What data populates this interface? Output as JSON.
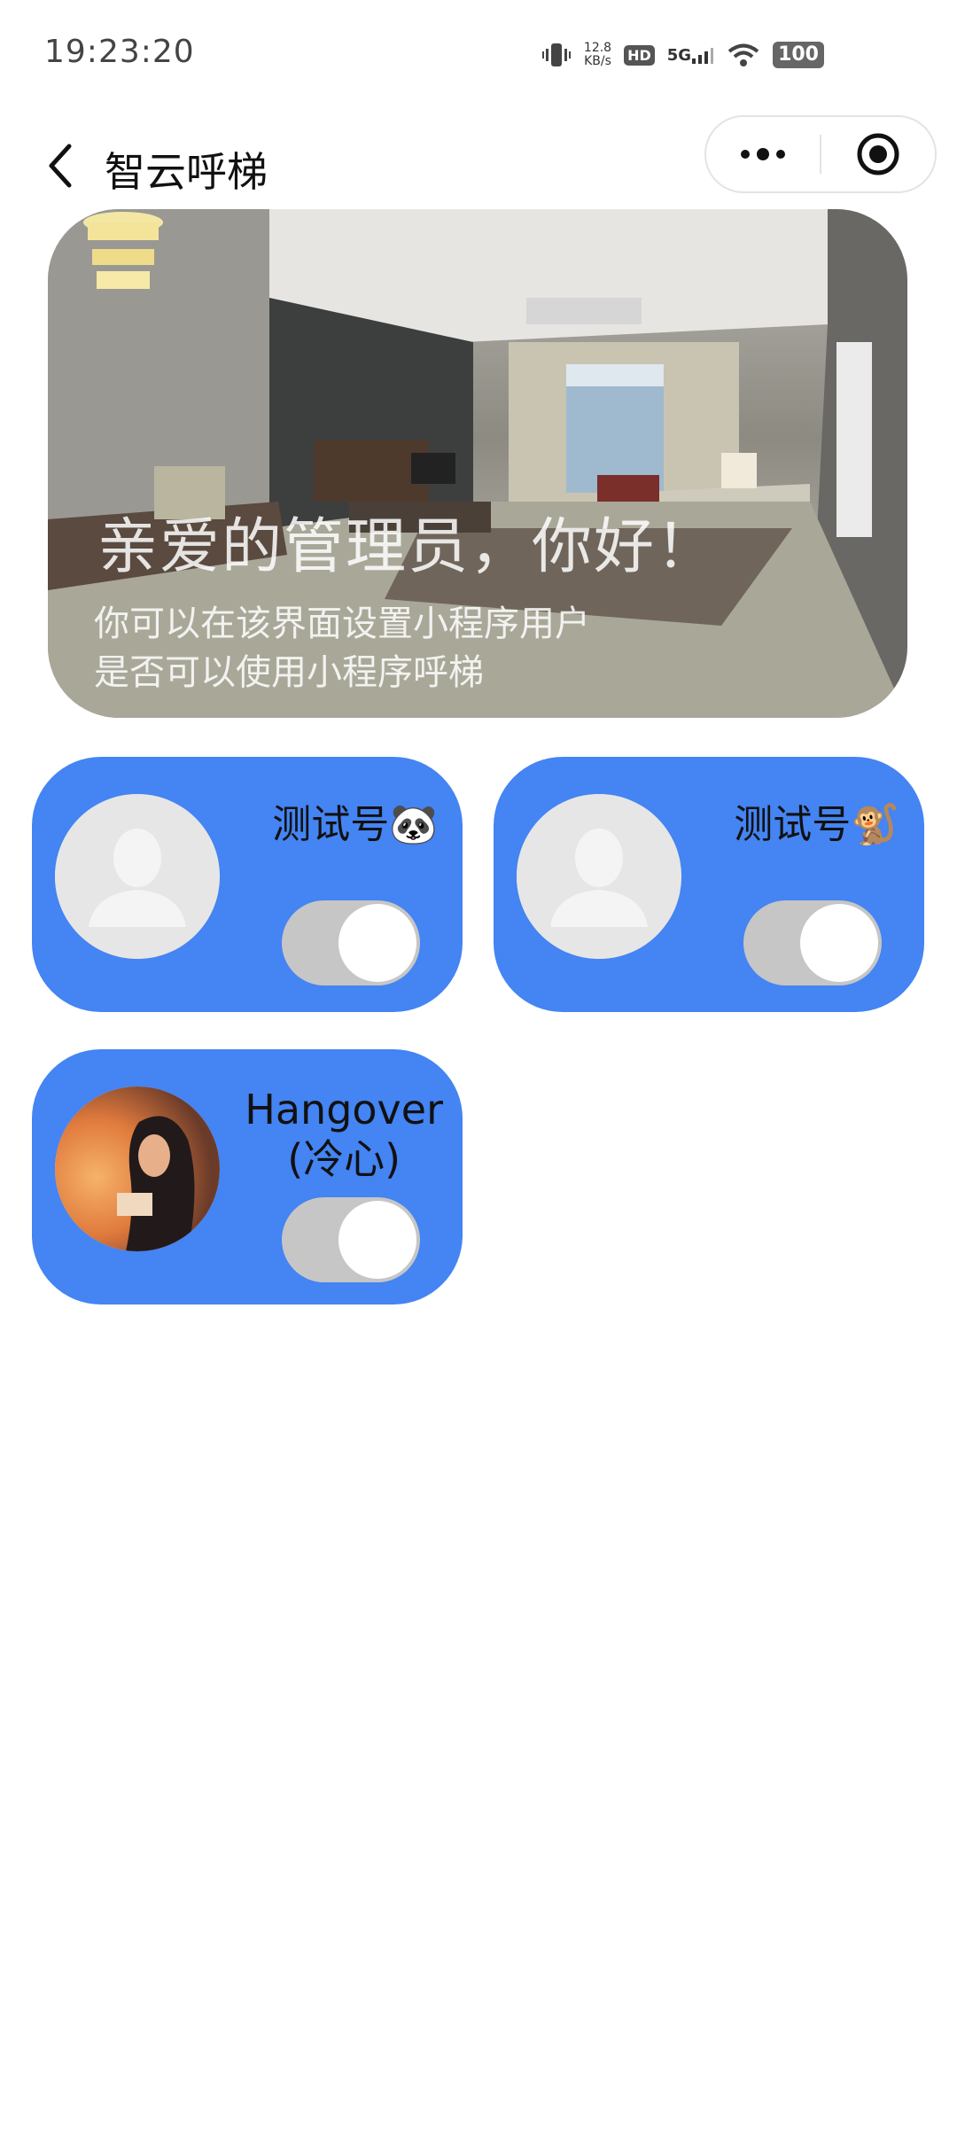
{
  "status_bar": {
    "time": "19:23:20",
    "net_speed_value": "12.8",
    "net_speed_unit": "KB/s",
    "hd": "HD",
    "network": "5G",
    "battery": "100"
  },
  "nav": {
    "title": "智云呼梯",
    "back_icon": "chevron-left-icon",
    "more_icon": "more-dots-icon",
    "close_icon": "target-circle-icon"
  },
  "banner": {
    "title": "亲爱的管理员，你好！",
    "line1": "你可以在该界面设置小程序用户",
    "line2": "是否可以使用小程序呼梯"
  },
  "users": [
    {
      "name": "测试号🐼",
      "avatar": "default-avatar-icon",
      "enabled": false
    },
    {
      "name": "测试号🐒",
      "avatar": "default-avatar-icon",
      "enabled": false
    },
    {
      "name_line1": "Hangover",
      "name_line2": "(冷心)",
      "avatar": "photo-avatar",
      "enabled": false
    }
  ],
  "colors": {
    "card": "#4484f3",
    "toggle_off": "#c6c6c6"
  }
}
